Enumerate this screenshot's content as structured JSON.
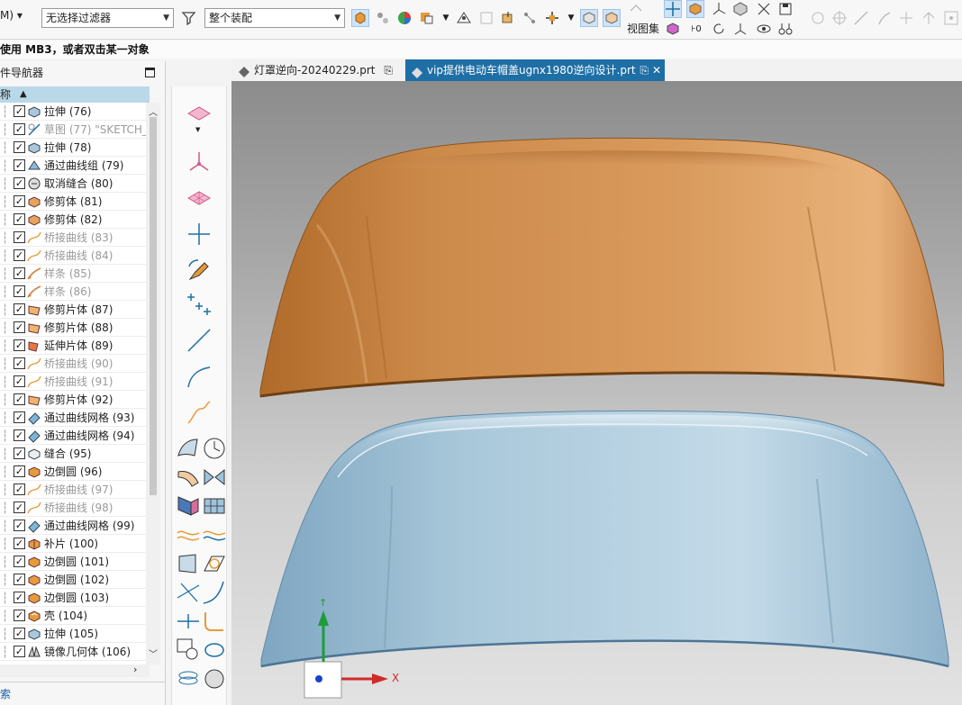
{
  "toolbar": {
    "menu_label": "M)",
    "filter_select": "无选择过滤器",
    "assembly_select": "整个装配",
    "view_set_label": "视图集"
  },
  "status_message": "使用 MB3，或者双击某一对象",
  "navigator": {
    "title": "部件导航器",
    "header_name": "名称",
    "search_label": "搜索",
    "items": [
      {
        "label": "拉伸 (76)",
        "icon": "extrude-icon",
        "dim": false
      },
      {
        "label": "草图 (77) \"SKETCH_",
        "icon": "sketch-icon",
        "dim": true
      },
      {
        "label": "拉伸 (78)",
        "icon": "extrude-icon",
        "dim": false
      },
      {
        "label": "通过曲线组 (79)",
        "icon": "through-curves-icon",
        "dim": false
      },
      {
        "label": "取消缝合 (80)",
        "icon": "unsew-icon",
        "dim": false
      },
      {
        "label": "修剪体 (81)",
        "icon": "trim-body-icon",
        "dim": false
      },
      {
        "label": "修剪体 (82)",
        "icon": "trim-body-icon",
        "dim": false
      },
      {
        "label": "桥接曲线 (83)",
        "icon": "bridge-curve-icon",
        "dim": true
      },
      {
        "label": "桥接曲线 (84)",
        "icon": "bridge-curve-icon",
        "dim": true
      },
      {
        "label": "样条 (85)",
        "icon": "spline-icon",
        "dim": true
      },
      {
        "label": "样条 (86)",
        "icon": "spline-icon",
        "dim": true
      },
      {
        "label": "修剪片体 (87)",
        "icon": "trim-sheet-icon",
        "dim": false
      },
      {
        "label": "修剪片体 (88)",
        "icon": "trim-sheet-icon",
        "dim": false
      },
      {
        "label": "延伸片体 (89)",
        "icon": "extend-sheet-icon",
        "dim": false
      },
      {
        "label": "桥接曲线 (90)",
        "icon": "bridge-curve-icon",
        "dim": true
      },
      {
        "label": "桥接曲线 (91)",
        "icon": "bridge-curve-icon",
        "dim": true
      },
      {
        "label": "修剪片体 (92)",
        "icon": "trim-sheet-icon",
        "dim": false
      },
      {
        "label": "通过曲线网格 (93)",
        "icon": "curve-mesh-icon",
        "dim": false
      },
      {
        "label": "通过曲线网格 (94)",
        "icon": "curve-mesh-icon",
        "dim": false
      },
      {
        "label": "缝合 (95)",
        "icon": "sew-icon",
        "dim": false
      },
      {
        "label": "边倒圆 (96)",
        "icon": "edge-blend-icon",
        "dim": false,
        "warning": true
      },
      {
        "label": "桥接曲线 (97)",
        "icon": "bridge-curve-icon",
        "dim": true
      },
      {
        "label": "桥接曲线 (98)",
        "icon": "bridge-curve-icon",
        "dim": true
      },
      {
        "label": "通过曲线网格 (99)",
        "icon": "curve-mesh-icon",
        "dim": false
      },
      {
        "label": "补片 (100)",
        "icon": "patch-icon",
        "dim": false
      },
      {
        "label": "边倒圆 (101)",
        "icon": "edge-blend-icon",
        "dim": false
      },
      {
        "label": "边倒圆 (102)",
        "icon": "edge-blend-icon",
        "dim": false
      },
      {
        "label": "边倒圆 (103)",
        "icon": "edge-blend-icon",
        "dim": false
      },
      {
        "label": "壳 (104)",
        "icon": "shell-icon",
        "dim": false
      },
      {
        "label": "拉伸 (105)",
        "icon": "extrude-icon",
        "dim": false
      },
      {
        "label": "镜像几何体 (106)",
        "icon": "mirror-geometry-icon",
        "dim": false
      }
    ]
  },
  "tabs": [
    {
      "label": "灯罩逆向-20240229.prt",
      "active": false
    },
    {
      "label": "vip提供电动车帽盖ugnx1980逆向设计.prt",
      "active": true
    }
  ],
  "triad": {
    "x_label": "X"
  },
  "colors": {
    "scan_mesh": "#c98a4b",
    "cad_model": "#a9c8da",
    "active_tab": "#1e6fa6",
    "nav_header": "#b9d9e8"
  }
}
